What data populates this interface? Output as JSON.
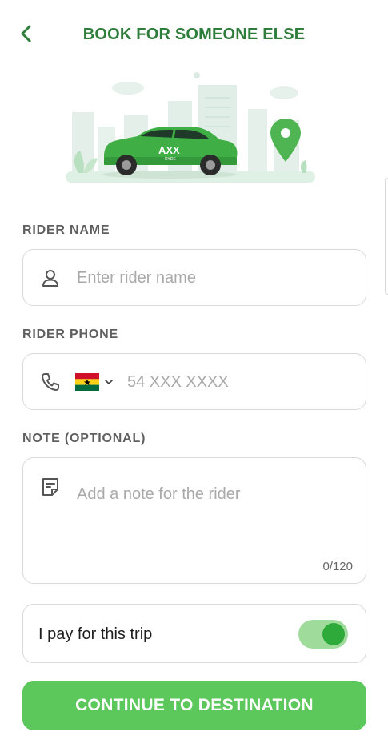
{
  "header": {
    "title": "BOOK FOR SOMEONE ELSE"
  },
  "hero": {
    "car_brand": "AXX",
    "car_subtext": "RYDE"
  },
  "rider_name": {
    "label": "RIDER NAME",
    "placeholder": "Enter rider name"
  },
  "rider_phone": {
    "label": "RIDER PHONE",
    "country": "Ghana",
    "placeholder": "54 XXX XXXX"
  },
  "note": {
    "label": "NOTE (OPTIONAL)",
    "placeholder": "Add a note for the rider",
    "counter": "0/120"
  },
  "pay_toggle": {
    "label": "I pay for this trip",
    "enabled": true
  },
  "cta": {
    "label": "CONTINUE TO DESTINATION"
  },
  "colors": {
    "brand_green": "#2e7d3a",
    "button_green": "#5cc75a",
    "toggle_on": "#2eaa3a"
  },
  "icons": [
    "back-arrow-icon",
    "person-icon",
    "phone-icon",
    "ghana-flag-icon",
    "chevron-down-icon",
    "note-icon",
    "location-pin-icon"
  ]
}
